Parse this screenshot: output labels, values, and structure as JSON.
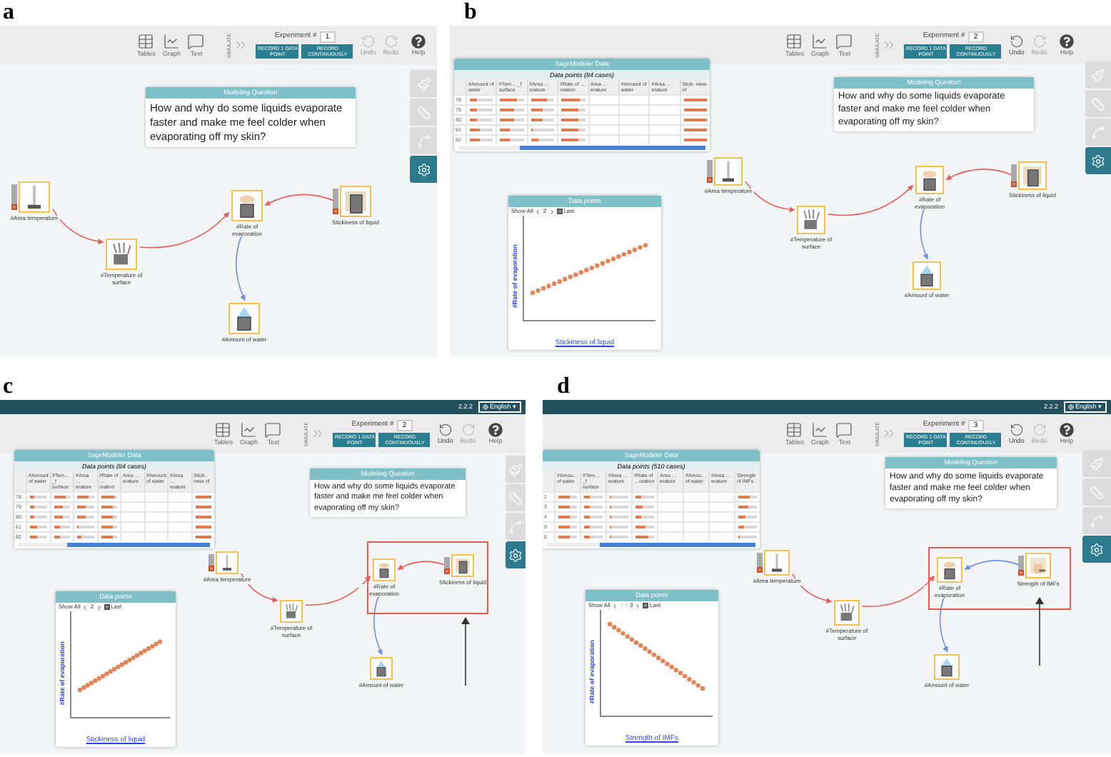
{
  "panels": [
    {
      "label": "a",
      "toolbar": {
        "tables": "Tables",
        "graph": "Graph",
        "text": "Text",
        "simulate": "SIMULATE",
        "experiment_label": "Experiment #",
        "experiment": "1",
        "record_point": "RECORD 1 DATA POINT",
        "record_continuous": "RECORD CONTINUOUSLY",
        "undo": {
          "label": "Undo",
          "disabled": true
        },
        "redo": {
          "label": "Redo",
          "disabled": true
        },
        "help": "Help"
      },
      "tools": [
        {
          "kind": "brush",
          "selected": false
        },
        {
          "kind": "ruler",
          "selected": false
        },
        {
          "kind": "curve",
          "selected": false
        },
        {
          "kind": "settings",
          "selected": true
        }
      ],
      "question": {
        "title": "Modeling Question",
        "text": "How and why do some liquids evaporate faster and make me feel colder when evaporating off my skin?"
      },
      "nodes": [
        {
          "label": "#Area temperature",
          "kind": "thermometer",
          "slider": true
        },
        {
          "label": "#Temperature of surface",
          "kind": "hand",
          "slider": false
        },
        {
          "label": "#Rate of evaporation",
          "kind": "dish",
          "slider": false
        },
        {
          "label": "Stickiness of liquid",
          "kind": "liquid",
          "slider": true
        },
        {
          "label": "#Amount of water",
          "kind": "drop",
          "slider": false
        }
      ],
      "links": [
        {
          "color": "#e06060"
        },
        {
          "color": "#e06060"
        },
        {
          "color": "#e06060"
        },
        {
          "color": "#6f8fe0"
        }
      ],
      "highlight": false
    },
    {
      "label": "b",
      "toolbar": {
        "tables": "Tables",
        "graph": "Graph",
        "text": "Text",
        "simulate": "SIMULATE",
        "experiment_label": "Experiment #",
        "experiment": "2",
        "record_point": "RECORD 1 DATA POINT",
        "record_continuous": "RECORD CONTINUOUSLY",
        "undo": {
          "label": "Undo",
          "disabled": false
        },
        "redo": {
          "label": "Redo",
          "disabled": true
        },
        "help": "Help"
      },
      "tools": [
        {
          "kind": "brush",
          "selected": false
        },
        {
          "kind": "ruler",
          "selected": false
        },
        {
          "kind": "curve",
          "selected": false
        },
        {
          "kind": "settings",
          "selected": true
        }
      ],
      "question": {
        "title": "Modeling Question",
        "text": "How and why do some liquids evaporate faster and make me feel colder when evaporating off my skin?"
      },
      "table": {
        "title": "SageModeler Data",
        "subtitle": "Data points (84 cases)",
        "columns": [
          "#Amount of water",
          "#Tem… _f surface",
          "#Area …erature",
          "#Rate of …oration",
          "Area …erature",
          "#Amount of water",
          "#Area …erature",
          "Stick- ness of"
        ],
        "rows": [
          {
            "number": "78",
            "cells": [
              {
                "kind": "bar",
                "level": 0.3
              },
              {
                "kind": "bar",
                "level": 0.7
              },
              {
                "kind": "bar",
                "level": 0.7
              },
              {
                "kind": "bar",
                "level": 0.8
              },
              {
                "kind": "blank"
              },
              {
                "kind": "blank"
              },
              {
                "kind": "blank"
              },
              {
                "kind": "bar",
                "level": 1
              }
            ]
          },
          {
            "number": "79",
            "cells": [
              {
                "kind": "bar",
                "level": 0.3
              },
              {
                "kind": "bar",
                "level": 0.6
              },
              {
                "kind": "bar",
                "level": 0.5
              },
              {
                "kind": "bar",
                "level": 0.75
              },
              {
                "kind": "blank"
              },
              {
                "kind": "blank"
              },
              {
                "kind": "blank"
              },
              {
                "kind": "bar",
                "level": 1
              }
            ]
          },
          {
            "number": "80",
            "cells": [
              {
                "kind": "bar",
                "level": 0.3
              },
              {
                "kind": "bar",
                "level": 0.6
              },
              {
                "kind": "bar",
                "level": 0.5
              },
              {
                "kind": "bar",
                "level": 0.75
              },
              {
                "kind": "blank"
              },
              {
                "kind": "blank"
              },
              {
                "kind": "blank"
              },
              {
                "kind": "bar",
                "level": 1
              }
            ]
          },
          {
            "number": "81",
            "cells": [
              {
                "kind": "bar",
                "level": 0.4
              },
              {
                "kind": "bar",
                "level": 0.4
              },
              {
                "kind": "bar",
                "level": 0.1
              },
              {
                "kind": "bar",
                "level": 0.7
              },
              {
                "kind": "blank"
              },
              {
                "kind": "blank"
              },
              {
                "kind": "blank"
              },
              {
                "kind": "bar",
                "level": 1
              }
            ]
          },
          {
            "number": "82",
            "cells": [
              {
                "kind": "bar",
                "level": 0.4
              },
              {
                "kind": "bar",
                "level": 0.4
              },
              {
                "kind": "bar",
                "level": 0.3
              },
              {
                "kind": "bar",
                "level": 0.7
              },
              {
                "kind": "blank"
              },
              {
                "kind": "blank"
              },
              {
                "kind": "blank"
              },
              {
                "kind": "bar",
                "level": 1
              }
            ]
          }
        ]
      },
      "graph": {
        "title": "Data points",
        "show_all": "Show All",
        "pages": [
          {
            "label": "2",
            "selected": true
          }
        ],
        "last": {
          "label": "Last",
          "checked": true
        },
        "kind": "rising",
        "y_label": "#Rate of evaporation",
        "x_label": "Stickiness of liquid"
      },
      "nodes": [
        {
          "label": "#Area temperature",
          "kind": "thermometer",
          "slider": true
        },
        {
          "label": "#Temperature of surface",
          "kind": "hand",
          "slider": false
        },
        {
          "label": "#Rate of evaporation",
          "kind": "dish",
          "slider": false
        },
        {
          "label": "Stickiness of liquid",
          "kind": "liquid",
          "slider": true
        },
        {
          "label": "#Amount of water",
          "kind": "drop",
          "slider": false
        }
      ],
      "links": [
        {
          "color": "#e06060"
        },
        {
          "color": "#e06060"
        },
        {
          "color": "#e06060"
        },
        {
          "color": "#6f8fe0"
        }
      ],
      "highlight": false
    },
    {
      "label": "c",
      "version_bar": {
        "version": "2.2.2",
        "language": "English ▾"
      },
      "toolbar": {
        "tables": "Tables",
        "graph": "Graph",
        "text": "Text",
        "simulate": "SIMULATE",
        "experiment_label": "Experiment #",
        "experiment": "2",
        "record_point": "RECORD 1 DATA POINT",
        "record_continuous": "RECORD CONTINUOUSLY",
        "undo": {
          "label": "Undo",
          "disabled": false
        },
        "redo": {
          "label": "Redo",
          "disabled": true
        },
        "help": "Help"
      },
      "tools": [
        {
          "kind": "brush",
          "selected": false
        },
        {
          "kind": "ruler",
          "selected": false
        },
        {
          "kind": "curve",
          "selected": false
        },
        {
          "kind": "settings",
          "selected": true
        }
      ],
      "question": {
        "title": "Modeling Question",
        "text": "How and why do some liquids evaporate faster and make me feel colder when evaporating off my skin?"
      },
      "table": {
        "title": "SageModeler Data",
        "subtitle": "Data points (84 cases)",
        "columns": [
          "#Amount of water",
          "#Tem… _f surface",
          "#Area …erature",
          "#Rate of …oration",
          "Area …erature",
          "#Amount of water",
          "#Area …erature",
          "Stick- ness of"
        ],
        "rows": [
          {
            "number": "78",
            "cells": [
              {
                "kind": "bar",
                "level": 0.3
              },
              {
                "kind": "bar",
                "level": 0.7
              },
              {
                "kind": "bar",
                "level": 0.7
              },
              {
                "kind": "bar",
                "level": 0.8
              },
              {
                "kind": "blank"
              },
              {
                "kind": "blank"
              },
              {
                "kind": "blank"
              },
              {
                "kind": "bar",
                "level": 1
              }
            ]
          },
          {
            "number": "79",
            "cells": [
              {
                "kind": "bar",
                "level": 0.3
              },
              {
                "kind": "bar",
                "level": 0.6
              },
              {
                "kind": "bar",
                "level": 0.5
              },
              {
                "kind": "bar",
                "level": 0.75
              },
              {
                "kind": "blank"
              },
              {
                "kind": "blank"
              },
              {
                "kind": "blank"
              },
              {
                "kind": "bar",
                "level": 1
              }
            ]
          },
          {
            "number": "80",
            "cells": [
              {
                "kind": "bar",
                "level": 0.3
              },
              {
                "kind": "bar",
                "level": 0.6
              },
              {
                "kind": "bar",
                "level": 0.5
              },
              {
                "kind": "bar",
                "level": 0.75
              },
              {
                "kind": "blank"
              },
              {
                "kind": "blank"
              },
              {
                "kind": "blank"
              },
              {
                "kind": "bar",
                "level": 1
              }
            ]
          },
          {
            "number": "81",
            "cells": [
              {
                "kind": "bar",
                "level": 0.4
              },
              {
                "kind": "bar",
                "level": 0.4
              },
              {
                "kind": "bar",
                "level": 0.1
              },
              {
                "kind": "bar",
                "level": 0.7
              },
              {
                "kind": "blank"
              },
              {
                "kind": "blank"
              },
              {
                "kind": "blank"
              },
              {
                "kind": "bar",
                "level": 1
              }
            ]
          },
          {
            "number": "82",
            "cells": [
              {
                "kind": "bar",
                "level": 0.4
              },
              {
                "kind": "bar",
                "level": 0.4
              },
              {
                "kind": "bar",
                "level": 0.3
              },
              {
                "kind": "bar",
                "level": 0.7
              },
              {
                "kind": "blank"
              },
              {
                "kind": "blank"
              },
              {
                "kind": "blank"
              },
              {
                "kind": "bar",
                "level": 1
              }
            ]
          }
        ]
      },
      "graph": {
        "title": "Data points",
        "show_all": "Show All",
        "pages": [
          {
            "label": "2",
            "selected": true
          }
        ],
        "last": {
          "label": "Last",
          "checked": true
        },
        "kind": "rising",
        "y_label": "#Rate of evaporation",
        "x_label": "Stickiness of liquid"
      },
      "nodes": [
        {
          "label": "#Area temperature",
          "kind": "thermometer",
          "slider": true
        },
        {
          "label": "#Temperature of surface",
          "kind": "hand",
          "slider": false
        },
        {
          "label": "#Rate of evaporation",
          "kind": "dish",
          "slider": false
        },
        {
          "label": "Stickiness of liquid",
          "kind": "liquid",
          "slider": true
        },
        {
          "label": "#Amount of water",
          "kind": "drop",
          "slider": false
        }
      ],
      "links": [
        {
          "color": "#e06060"
        },
        {
          "color": "#e06060"
        },
        {
          "color": "#e06060"
        },
        {
          "color": "#6f8fe0"
        }
      ],
      "highlight": true
    },
    {
      "label": "d",
      "version_bar": {
        "version": "2.2.2",
        "language": "English ▾"
      },
      "toolbar": {
        "tables": "Tables",
        "graph": "Graph",
        "text": "Text",
        "simulate": "SIMULATE",
        "experiment_label": "Experiment #",
        "experiment": "3",
        "record_point": "RECORD 1 DATA POINT",
        "record_continuous": "RECORD CONTINUOUSLY",
        "undo": {
          "label": "Undo",
          "disabled": false
        },
        "redo": {
          "label": "Redo",
          "disabled": true
        },
        "help": "Help"
      },
      "tools": [
        {
          "kind": "brush",
          "selected": false
        },
        {
          "kind": "ruler",
          "selected": false
        },
        {
          "kind": "curve",
          "selected": false
        },
        {
          "kind": "settings",
          "selected": true
        }
      ],
      "question": {
        "title": "Modeling Question",
        "text": "How and why do some liquids evaporate faster and make me feel colder when evaporating off my skin?"
      },
      "table": {
        "title": "SageModeler Data",
        "subtitle": "Data points (510 cases)",
        "columns": [
          "#Amou… of water",
          "#Tem… _f surface",
          "#Area …erature",
          "#Rate of …oration",
          "Area …erature",
          "#Amou… of water",
          "#Area …erature",
          "Strength of IMFs"
        ],
        "rows": [
          {
            "number": "2",
            "cells": [
              {
                "kind": "bar",
                "level": 0.6
              },
              {
                "kind": "bar",
                "level": 0.3
              },
              {
                "kind": "bar",
                "level": 0.05
              },
              {
                "kind": "bar",
                "level": 0.3
              },
              {
                "kind": "blank"
              },
              {
                "kind": "blank"
              },
              {
                "kind": "blank"
              },
              {
                "kind": "bar",
                "level": 0.6
              }
            ]
          },
          {
            "number": "3",
            "cells": [
              {
                "kind": "bar",
                "level": 0.6
              },
              {
                "kind": "bar",
                "level": 0.3
              },
              {
                "kind": "bar",
                "level": 0.05
              },
              {
                "kind": "bar",
                "level": 0.4
              },
              {
                "kind": "blank"
              },
              {
                "kind": "blank"
              },
              {
                "kind": "blank"
              },
              {
                "kind": "bar",
                "level": 0.5
              }
            ]
          },
          {
            "number": "4",
            "cells": [
              {
                "kind": "bar",
                "level": 0.6
              },
              {
                "kind": "bar",
                "level": 0.3
              },
              {
                "kind": "bar",
                "level": 0.05
              },
              {
                "kind": "bar",
                "level": 0.3
              },
              {
                "kind": "blank"
              },
              {
                "kind": "blank"
              },
              {
                "kind": "blank"
              },
              {
                "kind": "bar",
                "level": 0.4
              }
            ]
          },
          {
            "number": "5",
            "cells": [
              {
                "kind": "bar",
                "level": 0.6
              },
              {
                "kind": "bar",
                "level": 0.3
              },
              {
                "kind": "bar",
                "level": 0.05
              },
              {
                "kind": "bar",
                "level": 0.5
              },
              {
                "kind": "blank"
              },
              {
                "kind": "blank"
              },
              {
                "kind": "blank"
              },
              {
                "kind": "bar",
                "level": 0.3
              }
            ]
          },
          {
            "number": "6",
            "cells": [
              {
                "kind": "bar",
                "level": 0.6
              },
              {
                "kind": "bar",
                "level": 0.3
              },
              {
                "kind": "bar",
                "level": 0.05
              },
              {
                "kind": "bar",
                "level": 0.7
              },
              {
                "kind": "blank"
              },
              {
                "kind": "blank"
              },
              {
                "kind": "blank"
              },
              {
                "kind": "bar",
                "level": 0.1
              }
            ]
          }
        ]
      },
      "graph": {
        "title": "Data points",
        "show_all": "Show All",
        "pages": [
          {
            "label": "1",
            "selected": false
          },
          {
            "label": "2",
            "selected": false
          },
          {
            "label": "3",
            "selected": true
          }
        ],
        "last": {
          "label": "Last",
          "checked": true
        },
        "kind": "falling",
        "y_label": "#Rate of evaporation",
        "x_label": "Strength of IMFs"
      },
      "nodes": [
        {
          "label": "#Area temperature",
          "kind": "thermometer",
          "slider": true
        },
        {
          "label": "#Temperature of surface",
          "kind": "hand",
          "slider": false
        },
        {
          "label": "#Rate of evaporation",
          "kind": "dish",
          "slider": false
        },
        {
          "label": "Strength of IMFs",
          "kind": "jar",
          "slider": true
        },
        {
          "label": "#Amount of water",
          "kind": "drop",
          "slider": false
        }
      ],
      "links": [
        {
          "color": "#e06060"
        },
        {
          "color": "#e06060"
        },
        {
          "color": "#6f8fe0"
        },
        {
          "color": "#6f8fe0"
        }
      ],
      "highlight": true
    }
  ]
}
